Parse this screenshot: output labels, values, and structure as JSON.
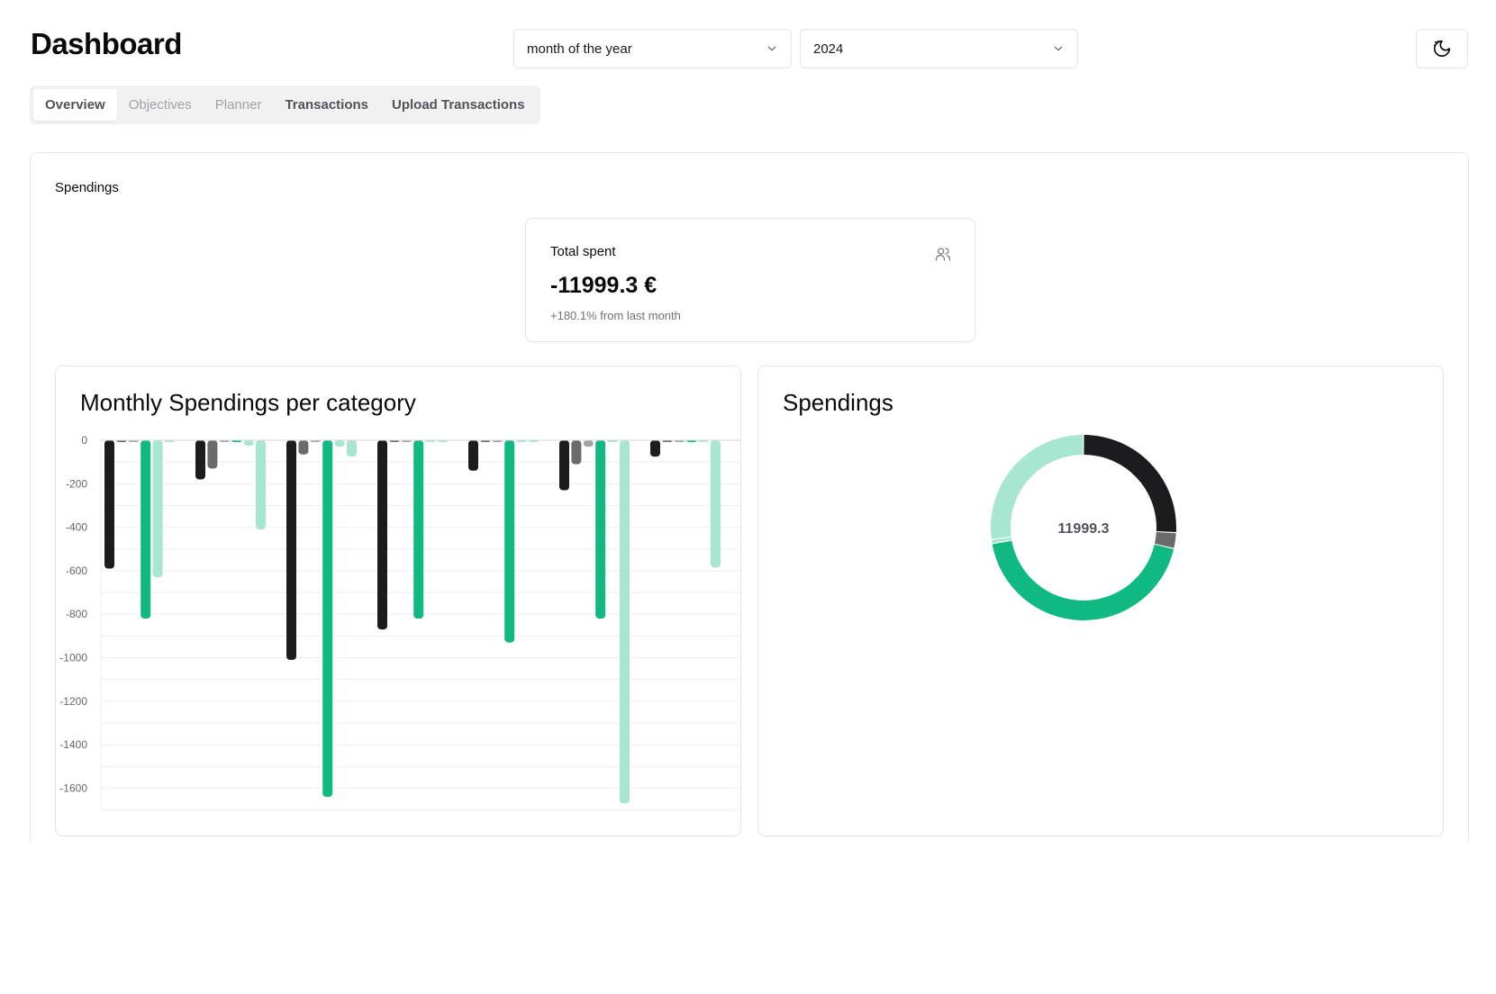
{
  "header": {
    "title": "Dashboard",
    "period_select": {
      "value": "month of the year",
      "icon": "chevron-down-icon"
    },
    "year_select": {
      "value": "2024",
      "icon": "chevron-down-icon"
    },
    "theme_toggle_icon": "theme-toggle-icon"
  },
  "tabs": [
    {
      "label": "Overview",
      "state": "active"
    },
    {
      "label": "Objectives",
      "state": "disabled"
    },
    {
      "label": "Planner",
      "state": "disabled"
    },
    {
      "label": "Transactions",
      "state": "normal"
    },
    {
      "label": "Upload Transactions",
      "state": "normal"
    }
  ],
  "spendings": {
    "section_label": "Spendings",
    "total": {
      "label": "Total spent",
      "value": "-11999.3 €",
      "change": "+180.1% from last month",
      "icon": "users-icon"
    }
  },
  "bar_chart": {
    "title": "Monthly Spendings per category"
  },
  "donut_chart": {
    "title": "Spendings",
    "center_label": "11999.3"
  },
  "colors": {
    "series_1": "#1c1c1e",
    "series_2": "#6b6b6b",
    "series_3": "#a3a3a3",
    "series_4": "#10b981",
    "series_5": "#a7e6d1"
  },
  "chart_data": [
    {
      "type": "bar",
      "title": "Monthly Spendings per category",
      "y_ticks": [
        0,
        -200,
        -400,
        -600,
        -800,
        -1000,
        -1200,
        -1400,
        -1600
      ],
      "ylim": [
        -1700,
        0
      ],
      "grid": true,
      "series": [
        {
          "color_key": "series_1",
          "values": [
            -590,
            -180,
            -1010,
            -870,
            -140,
            -230,
            -75
          ]
        },
        {
          "color_key": "series_2",
          "values": [
            -5,
            -130,
            -65,
            -5,
            -5,
            -110,
            -5
          ]
        },
        {
          "color_key": "series_3",
          "values": [
            -5,
            -5,
            -5,
            -5,
            -5,
            -30,
            -5
          ]
        },
        {
          "color_key": "series_4",
          "values": [
            -820,
            -5,
            -1640,
            -820,
            -930,
            -820,
            -5
          ]
        },
        {
          "color_key": "series_5",
          "values": [
            -630,
            -25,
            -30,
            -5,
            -5,
            -5,
            -5
          ]
        },
        {
          "color_key": "series_5",
          "values": [
            -5,
            -410,
            -75,
            -5,
            -5,
            -1670,
            -585
          ]
        }
      ]
    },
    {
      "type": "pie",
      "title": "Spendings",
      "center_label": "11999.3",
      "slices": [
        {
          "color_key": "series_1",
          "value": 3105
        },
        {
          "color_key": "series_2",
          "value": 330
        },
        {
          "color_key": "series_4",
          "value": 5230
        },
        {
          "color_key": "series_5",
          "value": 90
        },
        {
          "color_key": "series_5",
          "value": 3244
        }
      ]
    }
  ]
}
